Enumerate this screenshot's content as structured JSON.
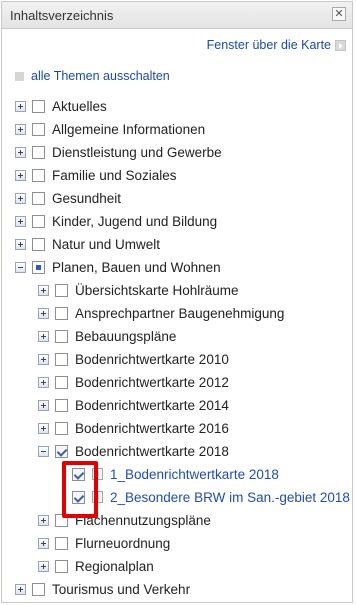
{
  "panel": {
    "title": "Inhaltsverzeichnis",
    "close_label": "✕",
    "position_link": "Fenster über die Karte",
    "toggle_all": "alle Themen ausschalten"
  },
  "tree": {
    "aktuelles": "Aktuelles",
    "allgemein": "Allgemeine Informationen",
    "dienstleistung": "Dienstleistung und Gewerbe",
    "familie": "Familie und Soziales",
    "gesundheit": "Gesundheit",
    "kinder": "Kinder, Jugend und Bildung",
    "natur": "Natur und Umwelt",
    "planen": "Planen, Bauen und Wohnen",
    "planen_children": {
      "uebersicht": "Übersichtskarte Hohlräume",
      "ansprech": "Ansprechpartner Baugenehmigung",
      "bebauung": "Bebauungspläne",
      "brw2010": "Bodenrichtwertkarte 2010",
      "brw2012": "Bodenrichtwertkarte 2012",
      "brw2014": "Bodenrichtwertkarte 2014",
      "brw2016": "Bodenrichtwertkarte 2016",
      "brw2018": "Bodenrichtwertkarte 2018",
      "brw2018_layers": {
        "layer1": "1_Bodenrichtwertkarte 2018",
        "layer2": "2_Besondere BRW im San.-gebiet 2018"
      },
      "flaechen": "Flächennutzungspläne",
      "flurneu": "Flurneuordnung",
      "regional": "Regionalplan"
    },
    "tourismus": "Tourismus und Verkehr"
  },
  "info_glyph": "i"
}
